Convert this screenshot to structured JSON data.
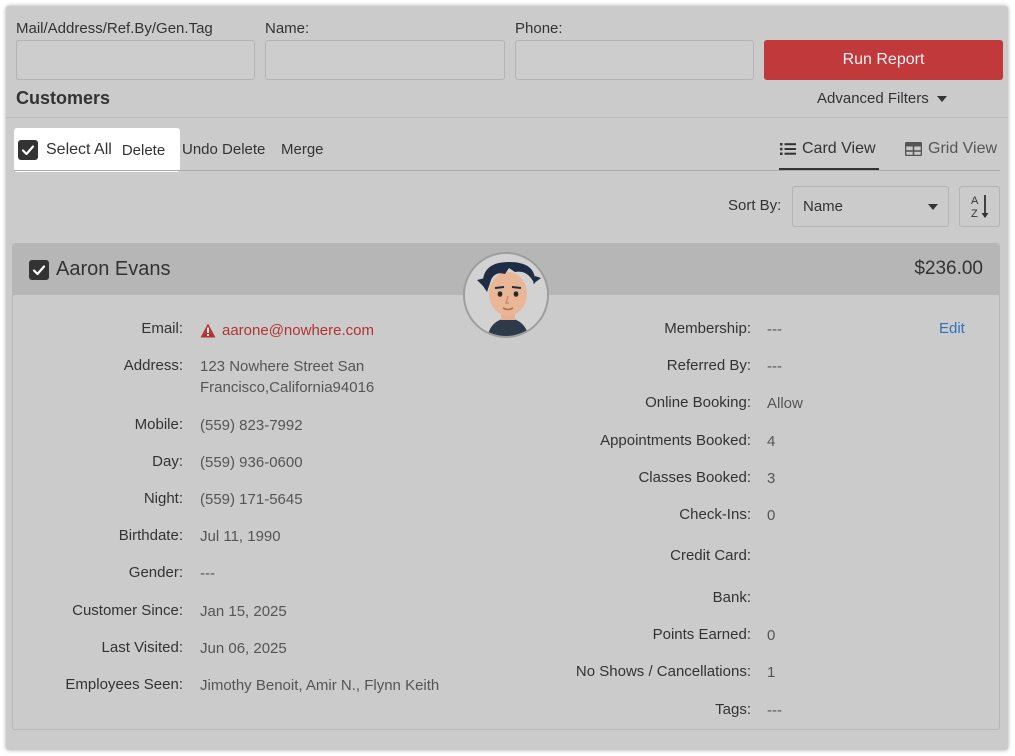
{
  "filters": {
    "mail_label": "Mail/Address/Ref.By/Gen.Tag",
    "mail_value": "",
    "name_label": "Name:",
    "name_value": "",
    "phone_label": "Phone:",
    "phone_value": "",
    "run_report": "Run Report"
  },
  "header": {
    "title": "Customers",
    "advanced_filters": "Advanced Filters"
  },
  "toolbar": {
    "select_all": "Select All",
    "delete": "Delete",
    "undo_delete": "Undo Delete",
    "merge": "Merge",
    "card_view": "Card View",
    "grid_view": "Grid View"
  },
  "sort": {
    "label": "Sort By:",
    "value": "Name",
    "az_top": "A",
    "az_bottom": "Z"
  },
  "customer": {
    "name": "Aaron Evans",
    "amount": "$236.00",
    "edit": "Edit",
    "left_fields": [
      {
        "label": "Email:",
        "value": "aarone@nowhere.com"
      },
      {
        "label": "Address:",
        "value": "123 Nowhere Street San Francisco,California94016"
      },
      {
        "label": "Mobile:",
        "value": "(559) 823-7992"
      },
      {
        "label": "Day:",
        "value": "(559) 936-0600"
      },
      {
        "label": "Night:",
        "value": "(559) 171-5645"
      },
      {
        "label": "Birthdate:",
        "value": "Jul 11, 1990"
      },
      {
        "label": "Gender:",
        "value": "---"
      },
      {
        "label": "Customer Since:",
        "value": "Jan 15, 2025"
      },
      {
        "label": "Last Visited:",
        "value": "Jun 06, 2025"
      },
      {
        "label": "Employees Seen:",
        "value": "Jimothy Benoit, Amir N., Flynn Keith"
      }
    ],
    "right_fields": [
      {
        "label": "Membership:",
        "value": "---"
      },
      {
        "label": "Referred By:",
        "value": "---"
      },
      {
        "label": "Online Booking:",
        "value": "Allow"
      },
      {
        "label": "Appointments Booked:",
        "value": "4"
      },
      {
        "label": "Classes Booked:",
        "value": "3"
      },
      {
        "label": "Check-Ins:",
        "value": "0"
      },
      {
        "label": "Credit Card:",
        "value": ""
      },
      {
        "label": "Bank:",
        "value": ""
      },
      {
        "label": "Points Earned:",
        "value": "0"
      },
      {
        "label": "No Shows / Cancellations:",
        "value": "1"
      },
      {
        "label": "Tags:",
        "value": "---"
      }
    ]
  },
  "colors": {
    "run_report_bg": "#c1393b",
    "email_warning": "#b33333",
    "edit_link": "#2e72c0"
  },
  "icons": {
    "select_all": "checkbox-checked-icon",
    "card_view": "list-icon",
    "grid_view": "grid-icon",
    "email_warning": "warning-triangle-icon",
    "sort_direction": "sort-az-icon"
  }
}
